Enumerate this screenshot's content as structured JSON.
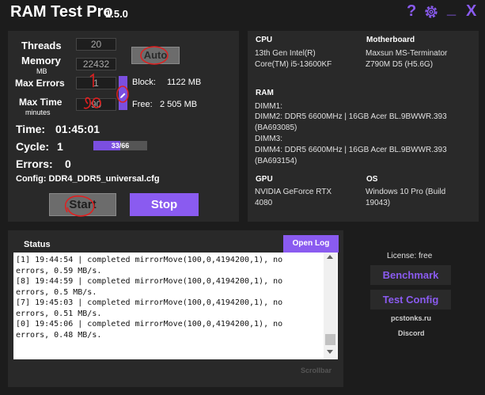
{
  "window": {
    "title": "RAM Test Pro",
    "version": "1.5.0"
  },
  "titlebar": {
    "help": "?",
    "settings_icon": "gear-icon",
    "minimize": "_",
    "close": "X"
  },
  "settings": {
    "threads_label": "Threads",
    "threads_value": "20",
    "memory_label": "Memory",
    "memory_unit": "MB",
    "memory_value": "22432",
    "auto_label": "Auto",
    "max_errors_label": "Max Errors",
    "max_errors_value": "1",
    "max_time_label": "Max Time",
    "max_time_unit": "minutes",
    "max_time_value": "90",
    "block_label": "Block:",
    "block_value": "1122 MB",
    "free_label": "Free:",
    "free_value": "2 505 MB"
  },
  "run": {
    "time_label": "Time:",
    "time_value": "01:45:01",
    "cycle_label": "Cycle:",
    "cycle_value": "1",
    "cycle_progress_text": "33/66",
    "cycle_progress_fraction": 0.5,
    "errors_label": "Errors:",
    "errors_value": "0",
    "config_label": "Config:",
    "config_value": "DDR4_DDR5_universal.cfg",
    "start_label": "Start",
    "stop_label": "Stop"
  },
  "system": {
    "cpu_label": "CPU",
    "cpu_line1": "13th Gen Intel(R)",
    "cpu_line2": "Core(TM) i5-13600KF",
    "mb_label": "Motherboard",
    "mb_line1": "Maxsun MS-Terminator",
    "mb_line2": "Z790M D5 (H5.6G)",
    "ram_label": "RAM",
    "ram_lines": [
      "DIMM1:",
      "DIMM2: DDR5 6600MHz | 16GB Acer BL.9BWWR.393",
      "(BA693085)",
      "DIMM3:",
      "DIMM4: DDR5 6600MHz | 16GB Acer BL.9BWWR.393",
      "(BA693154)"
    ],
    "gpu_label": "GPU",
    "gpu_line1": "NVIDIA GeForce RTX",
    "gpu_line2": "4080",
    "os_label": "OS",
    "os_line1": "Windows 10 Pro (Build",
    "os_line2": "19043)"
  },
  "status": {
    "title": "Status",
    "open_log_label": "Open Log",
    "log": [
      "[1] 19:44:54 | completed mirrorMove(100,0,4194200,1), no",
      "errors, 0.59 MB/s.",
      "[8] 19:44:59 | completed mirrorMove(100,0,4194200,1), no",
      "errors, 0.5 MB/s.",
      "[7] 19:45:03 | completed mirrorMove(100,0,4194200,1), no",
      "errors, 0.51 MB/s.",
      "[0] 19:45:06 | completed mirrorMove(100,0,4194200,1), no",
      "errors, 0.48 MB/s."
    ],
    "scrollbar_label": "Scrollbar"
  },
  "side": {
    "license": "License: free",
    "benchmark_label": "Benchmark",
    "test_config_label": "Test Config",
    "site_link": "pcstonks.ru",
    "discord_link": "Discord"
  },
  "colors": {
    "accent": "#8a5bf0",
    "panel": "#292929",
    "background": "#1c1c1c"
  }
}
